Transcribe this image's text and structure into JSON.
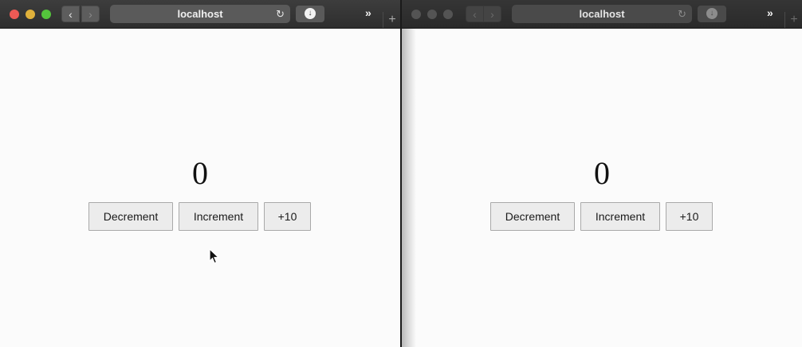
{
  "windows": [
    {
      "address": "localhost",
      "nav": {
        "back_icon": "chevron-left-icon",
        "forward_icon": "chevron-right-icon"
      },
      "counter_value": "0",
      "buttons": {
        "decrement": "Decrement",
        "increment": "Increment",
        "plus10": "+10"
      }
    },
    {
      "address": "localhost",
      "nav": {
        "back_icon": "chevron-left-icon",
        "forward_icon": "chevron-right-icon"
      },
      "counter_value": "0",
      "buttons": {
        "decrement": "Decrement",
        "increment": "Increment",
        "plus10": "+10"
      }
    }
  ],
  "colors": {
    "traffic_close": "#ee5a55",
    "traffic_minimize": "#e0b13b",
    "traffic_zoom": "#54c43c",
    "page_background": "#fbfbfb",
    "button_background": "#ececec"
  }
}
